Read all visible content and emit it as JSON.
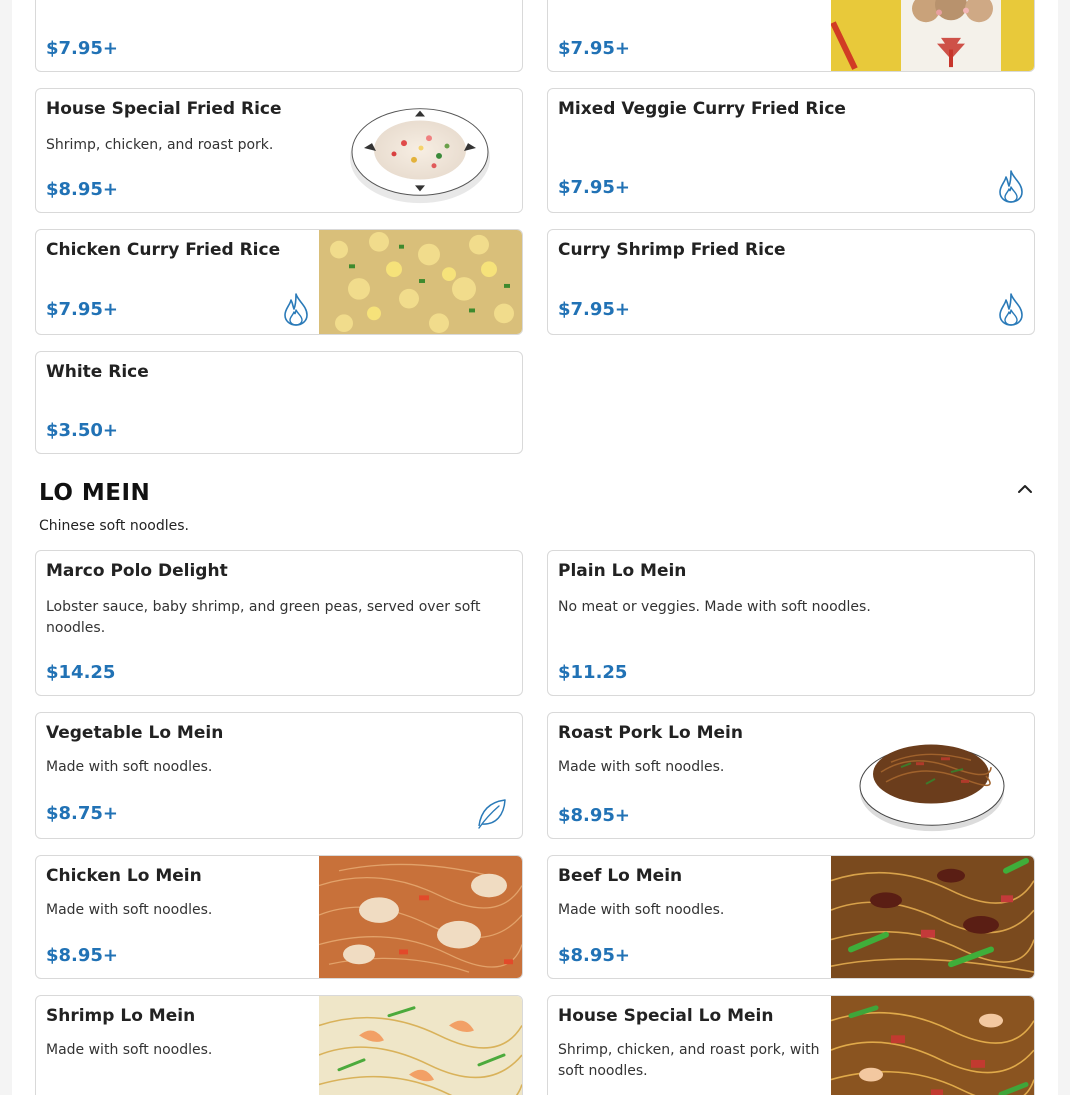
{
  "colors": {
    "price": "#2172b5",
    "icon": "#2a7ab8",
    "border": "#d9d9d9"
  },
  "top_row": {
    "left": {
      "price": "$7.95+"
    },
    "right": {
      "price": "$7.95+",
      "image": "fried-rice-takeout-box-photo"
    }
  },
  "fried_rice": {
    "items": [
      {
        "title": "House Special Fried Rice",
        "desc": "Shrimp, chicken, and roast pork.",
        "price": "$8.95+",
        "image": "house-special-fried-rice-photo"
      },
      {
        "title": "Mixed Veggie Curry Fried Rice",
        "price": "$7.95+",
        "icon": "spicy-flame-icon"
      },
      {
        "title": "Chicken Curry Fried Rice",
        "price": "$7.95+",
        "icon": "spicy-flame-icon",
        "image": "chicken-curry-fried-rice-photo"
      },
      {
        "title": "Curry Shrimp Fried Rice",
        "price": "$7.95+",
        "icon": "spicy-flame-icon"
      },
      {
        "title": "White Rice",
        "price": "$3.50+"
      }
    ]
  },
  "lo_mein": {
    "title": "LO MEIN",
    "description": "Chinese soft noodles.",
    "collapse_icon": "chevron-up-icon",
    "items": [
      {
        "title": "Marco Polo Delight",
        "desc": "Lobster sauce, baby shrimp, and green peas, served over soft noodles.",
        "price": "$14.25"
      },
      {
        "title": "Plain Lo Mein",
        "desc": "No meat or veggies. Made with soft noodles.",
        "price": "$11.25"
      },
      {
        "title": "Vegetable Lo Mein",
        "desc": "Made with soft noodles.",
        "price": "$8.75+",
        "icon": "vegetarian-leaf-icon"
      },
      {
        "title": "Roast Pork Lo Mein",
        "desc": "Made with soft noodles.",
        "price": "$8.95+",
        "image": "roast-pork-lo-mein-photo"
      },
      {
        "title": "Chicken Lo Mein",
        "desc": "Made with soft noodles.",
        "price": "$8.95+",
        "image": "chicken-lo-mein-photo"
      },
      {
        "title": "Beef Lo Mein",
        "desc": "Made with soft noodles.",
        "price": "$8.95+",
        "image": "beef-lo-mein-photo"
      },
      {
        "title": "Shrimp Lo Mein",
        "desc": "Made with soft noodles.",
        "image": "shrimp-lo-mein-photo"
      },
      {
        "title": "House Special Lo Mein",
        "desc": "Shrimp, chicken, and roast pork, with soft noodles.",
        "image": "house-special-lo-mein-photo"
      }
    ]
  }
}
